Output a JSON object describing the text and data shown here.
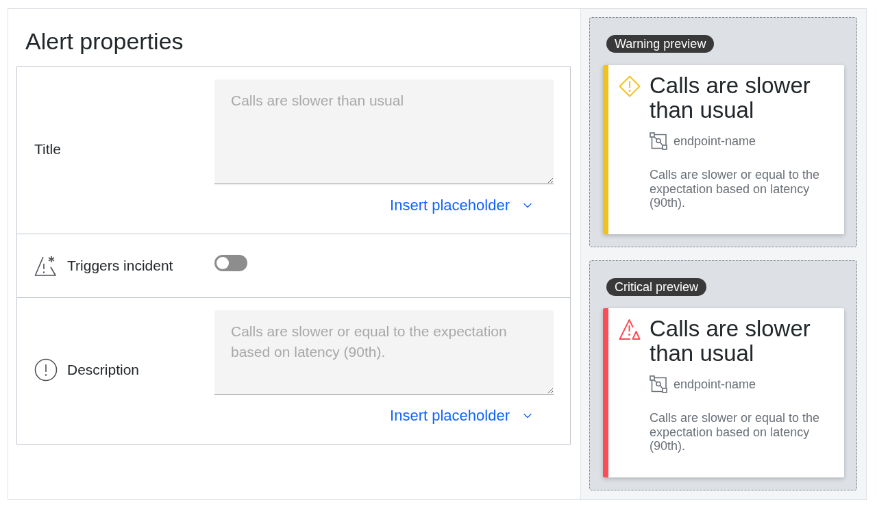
{
  "title": "Alert properties",
  "form": {
    "rows": [
      {
        "kind": "title",
        "label": "Title",
        "placeholder": "Calls are slower than usual",
        "action": "Insert placeholder"
      },
      {
        "kind": "trigger",
        "label": "Triggers incident",
        "on": false
      },
      {
        "kind": "description",
        "label": "Description",
        "placeholder": "Calls are slower or equal to the expectation based on latency (90th).",
        "action": "Insert placeholder"
      }
    ]
  },
  "previews": [
    {
      "kind": "warning",
      "badge": "Warning preview",
      "color": "#f1c21b",
      "title": "Calls are slower than usual",
      "entity": "endpoint-name",
      "description": "Calls are slower or equal to the expectation based on latency (90th)."
    },
    {
      "kind": "critical",
      "badge": "Critical preview",
      "color": "#fa4d56",
      "title": "Calls are slower than usual",
      "entity": "endpoint-name",
      "description": "Calls are slower or equal to the expectation based on latency (90th)."
    }
  ]
}
